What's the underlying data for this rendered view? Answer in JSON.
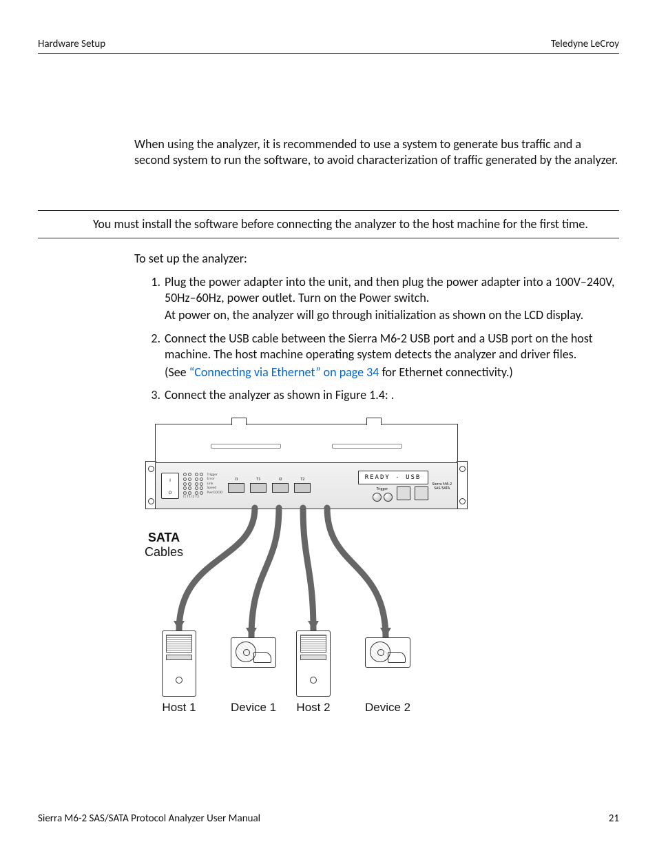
{
  "header": {
    "left": "Hardware Setup",
    "right": "Teledyne LeCroy"
  },
  "intro": "When using the analyzer, it is recommended to use a system to generate bus traffic and a second system to run the software, to avoid characterization of traffic generated by the analyzer.",
  "callout": "You must install the software before connecting the analyzer to the host machine for the first time.",
  "lead": "To set up the analyzer:",
  "steps": {
    "n1": "1.",
    "t1a": "Plug the power adapter into the unit, and then plug the power adapter into a 100V–240V, 50Hz–60Hz, power outlet. Turn on the Power switch.",
    "t1b": "At power on, the analyzer will go through initialization as shown on the LCD display.",
    "n2": "2.",
    "t2a": "Connect the USB cable between the Sierra M6-2 USB port and a USB port on the host machine. The host machine operating system detects the analyzer and driver files.",
    "t2b_pre": "(See ",
    "t2b_link": "“Connecting via Ethernet” on page 34",
    "t2b_post": " for Ethernet connectivity.)",
    "n3": "3.",
    "t3": "Connect the analyzer as shown in Figure 1.4:  ."
  },
  "figure": {
    "sata_label_l1": "SATA",
    "sata_label_l2": "Cables",
    "lcd_text": "READY - USB",
    "ports": {
      "i1": "I1",
      "t1": "T1",
      "i2": "I2",
      "t2": "T2"
    },
    "trigger_label": "Trigger",
    "brand_l1": "Sierra M6-2",
    "brand_l2": "SAS/SATA",
    "led_labels": [
      "Trigger",
      "Error",
      "Link",
      "Speed",
      "PwrGOOD"
    ],
    "led_bottom": "I1 T1   I2 T2",
    "pwr_on": "I",
    "pwr_off": "O",
    "dev1": "Device 1",
    "dev2": "Device 2",
    "host1": "Host 1",
    "host2": "Host 2"
  },
  "footer": {
    "left": "Sierra M6-2 SAS/SATA Protocol Analyzer User Manual",
    "right": "21"
  }
}
